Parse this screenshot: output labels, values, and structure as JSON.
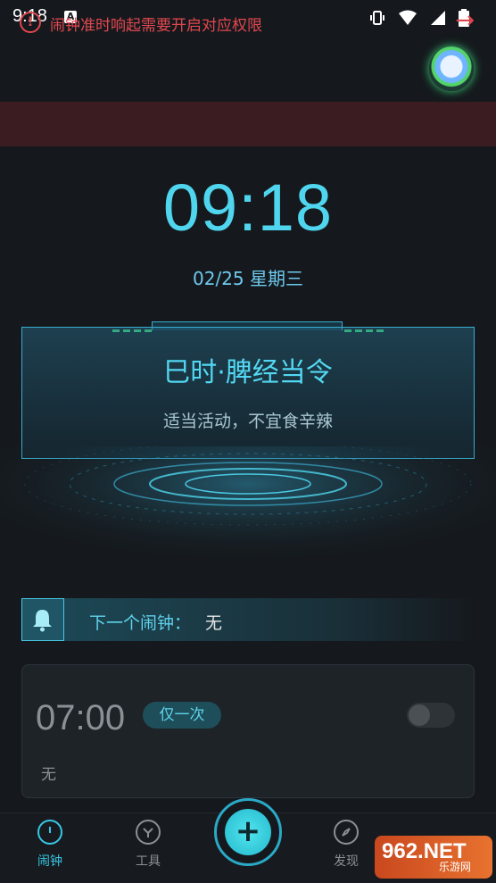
{
  "status_bar": {
    "time": "9:18",
    "a_badge": "A"
  },
  "banner": {
    "text": "闹钟准时响起需要开启对应权限",
    "warn_glyph": "!",
    "arrow_glyph": "→"
  },
  "clock": {
    "time": "09:18",
    "date": "02/25 星期三"
  },
  "panel": {
    "title": "巳时·脾经当令",
    "subtitle": "适当活动，不宜食辛辣"
  },
  "next_alarm": {
    "label": "下一个闹钟：",
    "value": "无"
  },
  "alarm_card": {
    "time": "07:00",
    "repeat": "仅一次",
    "note": "无",
    "enabled": false
  },
  "nav": {
    "items": [
      {
        "label": "闹钟",
        "icon": "alarm-clock-icon",
        "active": true
      },
      {
        "label": "工具",
        "icon": "tools-icon",
        "active": false
      },
      {
        "label": "发现",
        "icon": "compass-icon",
        "active": false
      }
    ],
    "fab_glyph": "+"
  },
  "watermark": {
    "big": "962.NET",
    "small": "乐游网"
  },
  "colors": {
    "accent": "#4fd6ee",
    "warning": "#e2474f",
    "background": "#15191d"
  }
}
